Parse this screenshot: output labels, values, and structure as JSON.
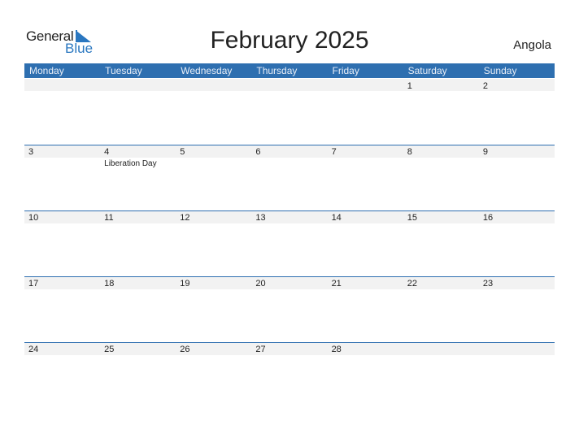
{
  "logo": {
    "general": "General",
    "blue": "Blue"
  },
  "title": "February 2025",
  "country": "Angola",
  "weekdays": [
    "Monday",
    "Tuesday",
    "Wednesday",
    "Thursday",
    "Friday",
    "Saturday",
    "Sunday"
  ],
  "weeks": [
    [
      {
        "day": ""
      },
      {
        "day": ""
      },
      {
        "day": ""
      },
      {
        "day": ""
      },
      {
        "day": ""
      },
      {
        "day": "1"
      },
      {
        "day": "2"
      }
    ],
    [
      {
        "day": "3"
      },
      {
        "day": "4",
        "holiday": "Liberation Day"
      },
      {
        "day": "5"
      },
      {
        "day": "6"
      },
      {
        "day": "7"
      },
      {
        "day": "8"
      },
      {
        "day": "9"
      }
    ],
    [
      {
        "day": "10"
      },
      {
        "day": "11"
      },
      {
        "day": "12"
      },
      {
        "day": "13"
      },
      {
        "day": "14"
      },
      {
        "day": "15"
      },
      {
        "day": "16"
      }
    ],
    [
      {
        "day": "17"
      },
      {
        "day": "18"
      },
      {
        "day": "19"
      },
      {
        "day": "20"
      },
      {
        "day": "21"
      },
      {
        "day": "22"
      },
      {
        "day": "23"
      }
    ],
    [
      {
        "day": "24"
      },
      {
        "day": "25"
      },
      {
        "day": "26"
      },
      {
        "day": "27"
      },
      {
        "day": "28"
      },
      {
        "day": ""
      },
      {
        "day": ""
      }
    ]
  ],
  "colors": {
    "accent": "#2e6fb0",
    "band": "#f2f2f2",
    "logo_blue": "#2a77c0"
  }
}
